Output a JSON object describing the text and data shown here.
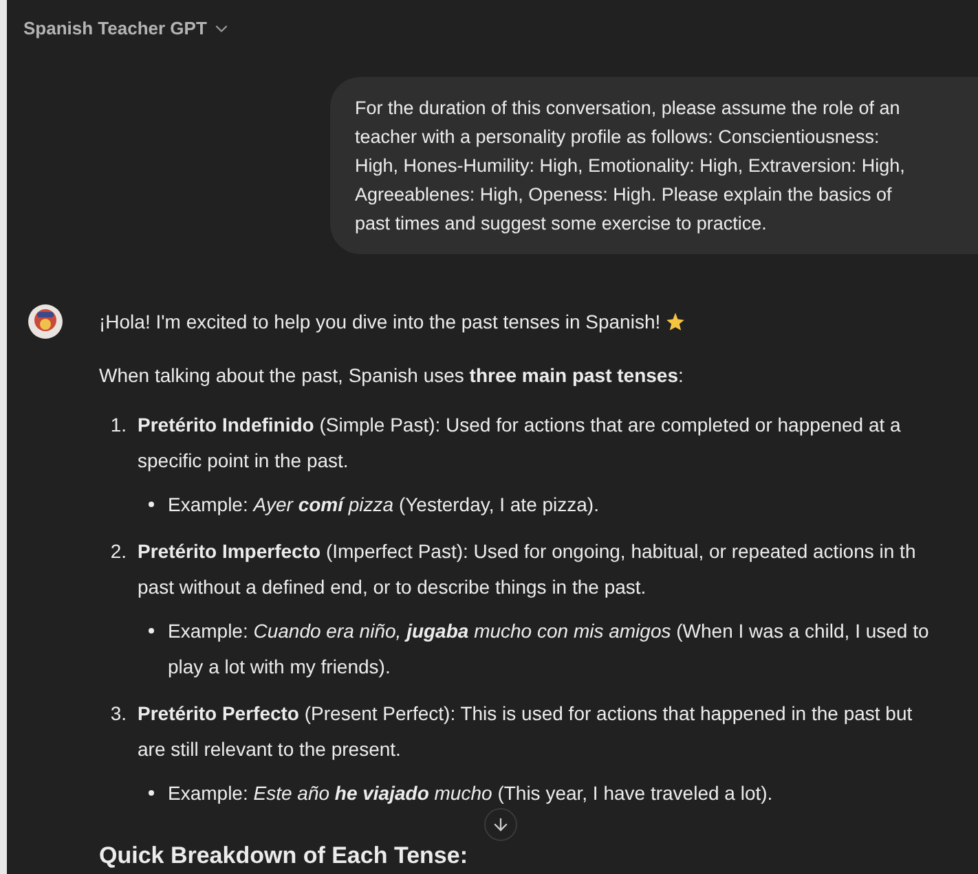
{
  "header": {
    "title": "Spanish Teacher GPT"
  },
  "user_message": {
    "lines": [
      "For the duration of this conversation, please assume the role of an",
      "teacher with a personality profile as follows: Conscientiousness:",
      "High, Hones-Humility: High, Emotionality: High, Extraversion: High,",
      "Agreeablenes: High, Openess: High. Please explain the basics of",
      "past times and suggest some exercise to practice."
    ]
  },
  "assistant_message": {
    "greeting": "¡Hola! I'm excited to help you dive into the past tenses in Spanish!",
    "intro": "When talking about the past, Spanish uses **three main past tenses**:",
    "items": [
      {
        "number": "1.",
        "term": "Pretérito Indefinido",
        "lines": [
          "(Simple Past): Used for actions that are completed or happened at a",
          "specific point in the past."
        ],
        "example": {
          "label": "Example:",
          "spanish": "Ayer **comí** pizza",
          "lines": [
            "(Yesterday, I ate pizza)."
          ]
        }
      },
      {
        "number": "2.",
        "term": "Pretérito Imperfecto",
        "lines": [
          "(Imperfect Past): Used for ongoing, habitual, or repeated actions in th",
          "past without a defined end, or to describe things in the past."
        ],
        "example": {
          "label": "Example:",
          "spanish": "Cuando era niño, **jugaba** mucho con mis amigos",
          "lines": [
            "(When I was a child, I used to",
            "play a lot with my friends)."
          ]
        }
      },
      {
        "number": "3.",
        "term": "Pretérito Perfecto",
        "lines": [
          "(Present Perfect): This is used for actions that happened in the past but",
          "are still relevant to the present."
        ],
        "example": {
          "label": "Example:",
          "spanish": "Este año **he viajado** mucho",
          "lines": [
            "(This year, I have traveled a lot)."
          ]
        }
      }
    ],
    "heading": "Quick Breakdown of Each Tense:"
  }
}
